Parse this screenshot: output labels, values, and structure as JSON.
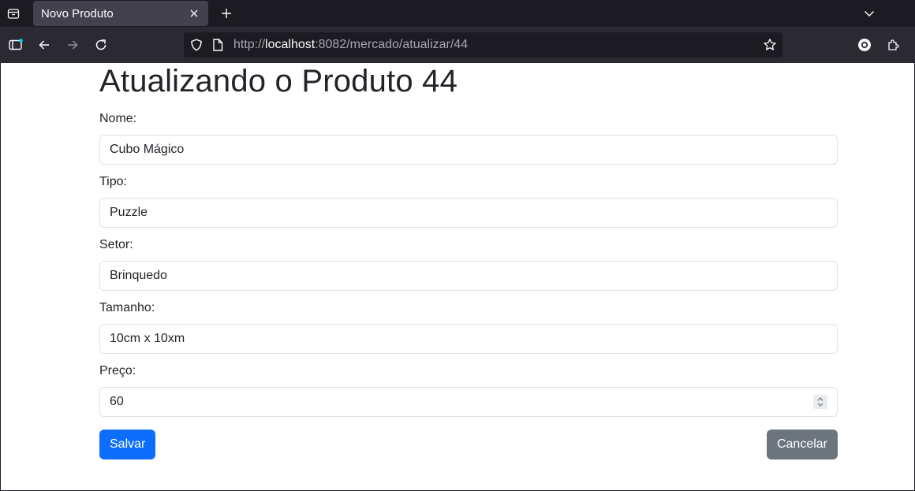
{
  "browser": {
    "tab": {
      "title": "Novo Produto"
    },
    "url": {
      "scheme": "http://",
      "host": "localhost",
      "rest": ":8082/mercado/atualizar/44"
    }
  },
  "page": {
    "title": "Atualizando o Produto 44",
    "fields": [
      {
        "label": "Nome:",
        "value": "Cubo Mágico"
      },
      {
        "label": "Tipo:",
        "value": "Puzzle"
      },
      {
        "label": "Setor:",
        "value": "Brinquedo"
      },
      {
        "label": "Tamanho:",
        "value": "10cm x 10xm"
      },
      {
        "label": "Preço:",
        "value": "60"
      }
    ],
    "buttons": {
      "save": "Salvar",
      "cancel": "Cancelar"
    }
  },
  "colors": {
    "primary": "#0d6efd",
    "secondary": "#6c757d",
    "chrome_dark": "#1c1b22",
    "chrome_toolbar": "#2b2a33"
  },
  "icons": [
    "tab-overview-icon",
    "close-icon",
    "plus-icon",
    "chevron-down-icon",
    "sidebar-icon",
    "back-arrow-icon",
    "forward-arrow-icon",
    "reload-icon",
    "shield-icon",
    "page-icon",
    "star-icon",
    "account-icon",
    "extensions-icon"
  ]
}
